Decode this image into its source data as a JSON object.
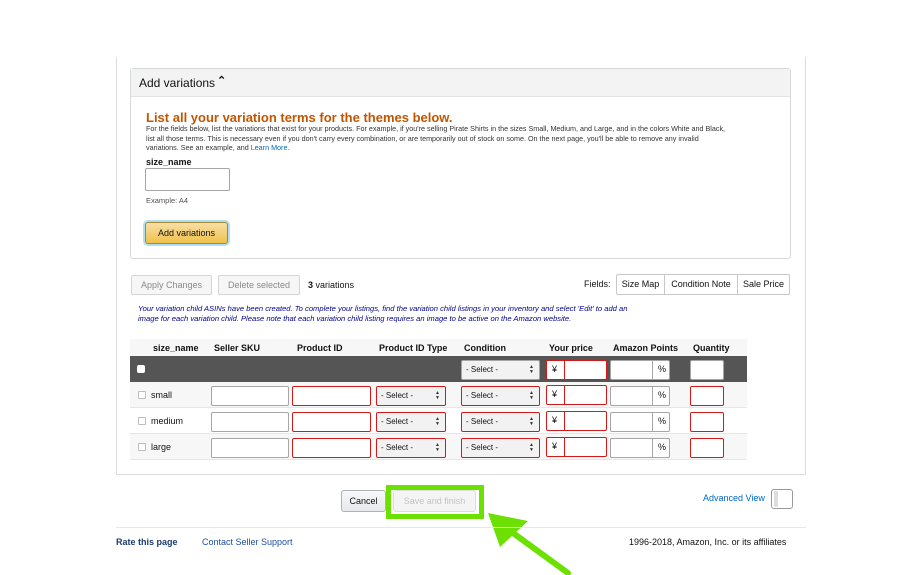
{
  "variations_section": {
    "title": "Add variations",
    "heading": "List all your variation terms for the themes below.",
    "description": "For the fields below, list the variations that exist for your products. For example, if you're selling Pirate Shirts in the sizes Small, Medium, and Large, and in the colors White and Black, list all those terms. This is necessary even if you don't carry every combination, or are temporarily out of stock on some. On the next page, you'll be able to remove any invalid variations. See an example, and",
    "learn_more": "Learn More.",
    "field_label": "size_name",
    "field_value": "",
    "example": "Example:  A4",
    "add_button": "Add variations"
  },
  "toolbar": {
    "apply_changes": "Apply Changes",
    "delete_selected": "Delete selected",
    "variation_count": "3",
    "variation_word": "variations",
    "fields_label": "Fields:",
    "field_buttons": [
      "Size Map",
      "Condition Note",
      "Sale Price"
    ]
  },
  "notice": "Your variation child ASINs have been created. To complete your listings, find the variation child listings in your inventory and select 'Edit' to add an image for each variation child. Please note that each variation child listing requires an image to be active on the Amazon website.",
  "table": {
    "columns": [
      "size_name",
      "Seller SKU",
      "Product ID",
      "Product ID Type",
      "Condition",
      "Your price",
      "Amazon Points",
      "Quantity"
    ],
    "select_placeholder": "- Select -",
    "currency": "¥",
    "percent": "%",
    "rows": [
      {
        "size": "small"
      },
      {
        "size": "medium"
      },
      {
        "size": "large"
      }
    ]
  },
  "footer": {
    "cancel": "Cancel",
    "save_and_finish": "Save and finish",
    "advanced_view": "Advanced View",
    "rate_page": "Rate this page",
    "contact_support": "Contact Seller Support",
    "copyright": "1996-2018, Amazon, Inc. or its affiliates"
  },
  "colors": {
    "highlight": "#6ce000",
    "heading_orange": "#c45500",
    "required_red": "#d41919",
    "notice_blue": "#00008b"
  }
}
